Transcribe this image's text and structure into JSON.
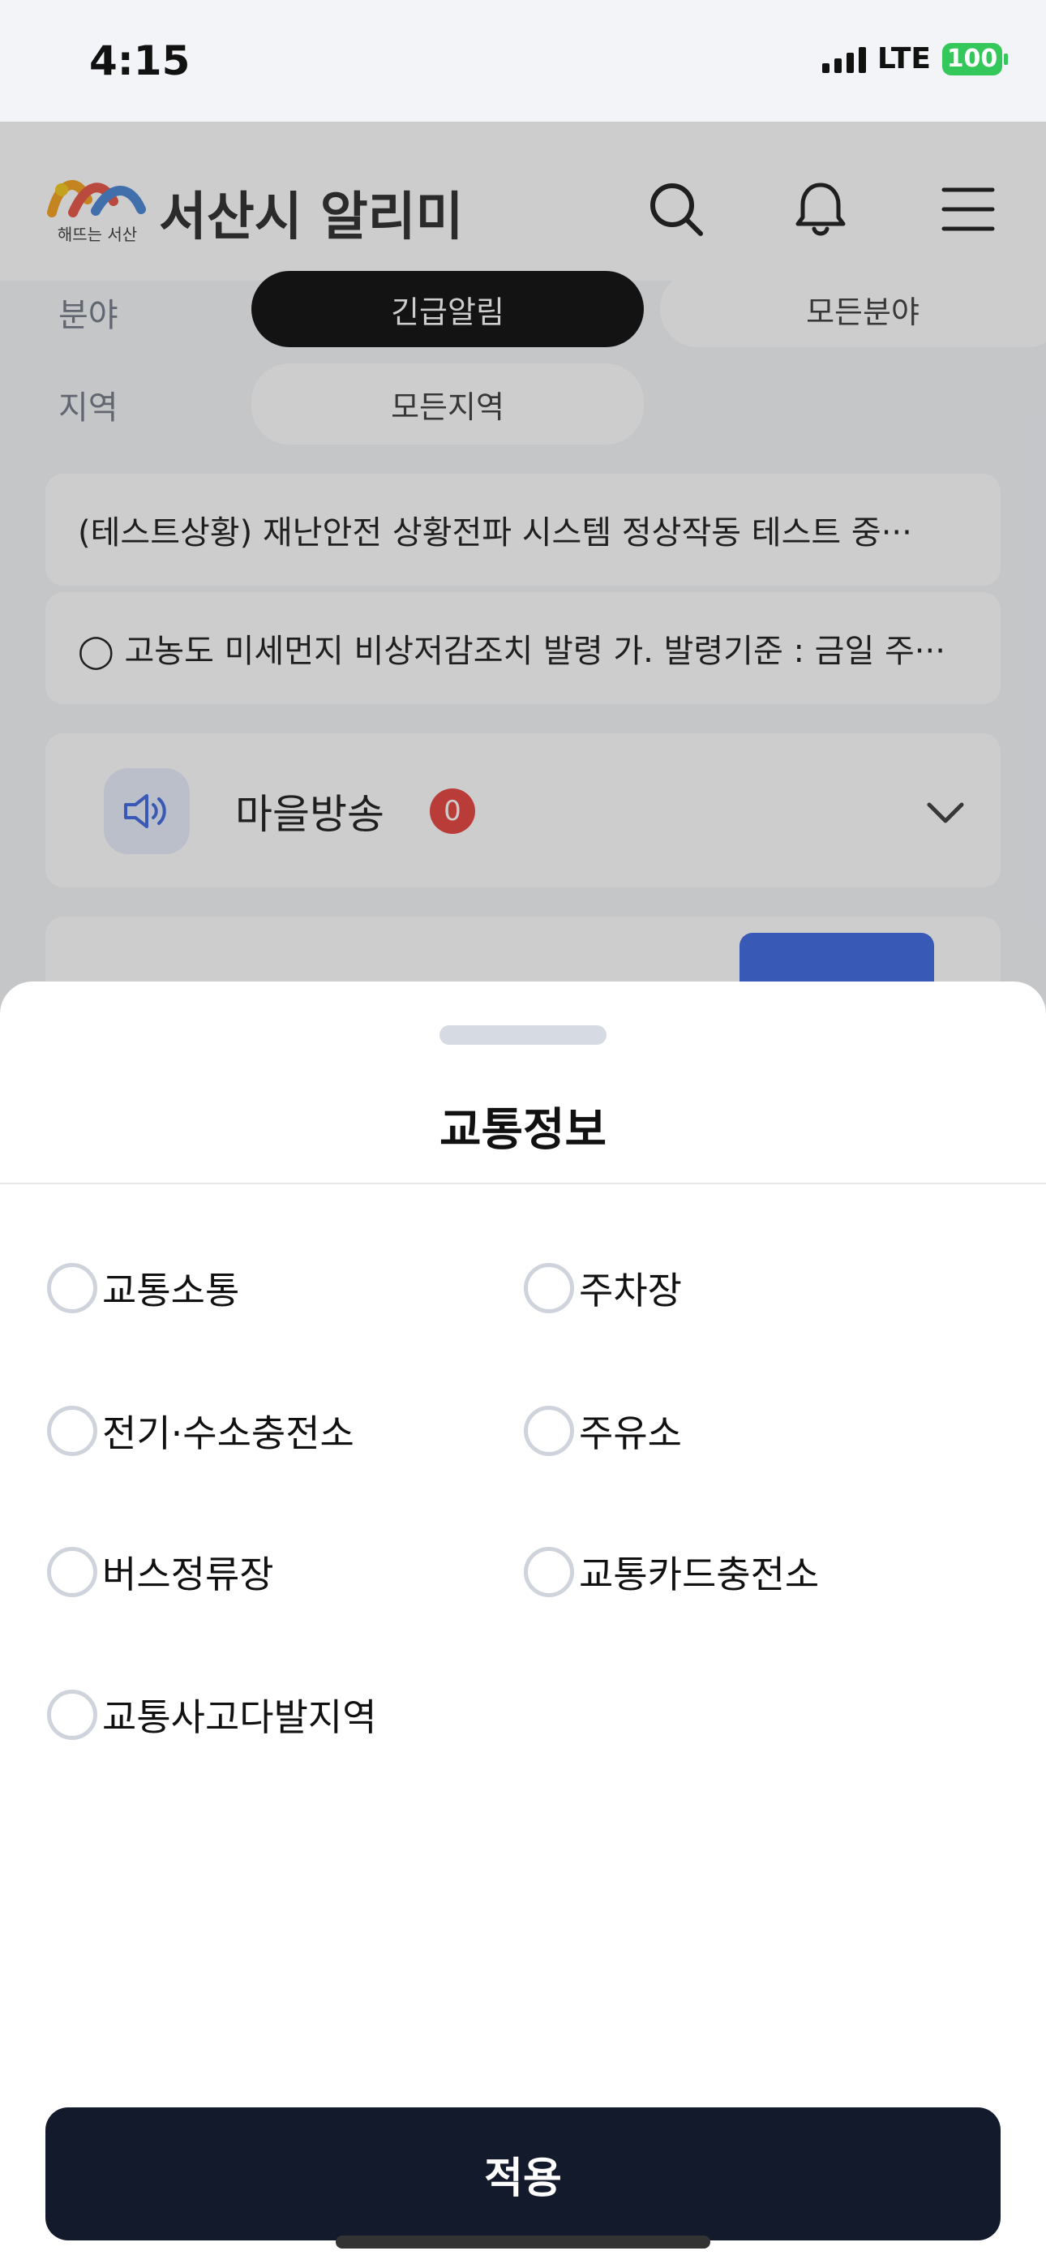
{
  "status_bar": {
    "time": "4:15",
    "network": "LTE",
    "battery": "100"
  },
  "header": {
    "logo_text": "해뜨는 서산",
    "title": "서산시 알리미"
  },
  "filters": {
    "field_label": "분야",
    "field_chips": [
      "긴급알림",
      "모든분야"
    ],
    "region_label": "지역",
    "region_chip": "모든지역"
  },
  "notices": [
    "(테스트상황) 재난안전 상황전파 시스템 정상작동 테스트 중···",
    "◯ 고농도 미세먼지 비상저감조치 발령 가. 발령기준 : 금일 주···"
  ],
  "broadcast": {
    "label": "마을방송",
    "count": "0"
  },
  "sheet": {
    "title": "교통정보",
    "options": [
      "교통소통",
      "주차장",
      "전기·수소충전소",
      "주유소",
      "버스정류장",
      "교통카드충전소",
      "교통사고다발지역"
    ],
    "apply_label": "적용"
  },
  "colors": {
    "accent_blue": "#3461e0",
    "badge_red": "#e53935",
    "apply_button": "#131a2b",
    "battery_green": "#34c759"
  }
}
